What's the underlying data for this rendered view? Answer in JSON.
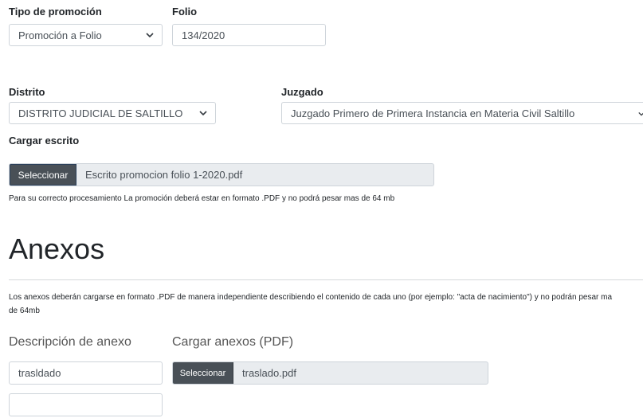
{
  "promocion": {
    "tipo_label": "Tipo de promoción",
    "tipo_value": "Promoción a Folio",
    "folio_label": "Folio",
    "folio_value": "134/2020"
  },
  "ubicacion": {
    "distrito_label": "Distrito",
    "distrito_value": "DISTRITO JUDICIAL DE SALTILLO",
    "juzgado_label": "Juzgado",
    "juzgado_value": "Juzgado Primero de Primera Instancia en Materia Civil Saltillo"
  },
  "escrito": {
    "label": "Cargar escrito",
    "button": "Seleccionar",
    "filename": "Escrito promocion folio 1-2020.pdf",
    "help": "Para su correcto procesamiento La promoción deberá estar en formato .PDF y no podrá pesar mas de 64 mb"
  },
  "anexos": {
    "title": "Anexos",
    "note_line1": "Los anexos deberán cargarse en formato .PDF de manera independiente describiendo el contenido de cada uno (por ejemplo: \"acta de nacimiento\") y no podrán pesar ma",
    "note_line2": "de 64mb",
    "descripcion_header": "Descripción de anexo",
    "cargar_header": "Cargar anexos (PDF)",
    "rows": [
      {
        "descripcion": "trasldado",
        "button": "Seleccionar",
        "filename": "traslado.pdf"
      },
      {
        "descripcion": ""
      }
    ]
  }
}
